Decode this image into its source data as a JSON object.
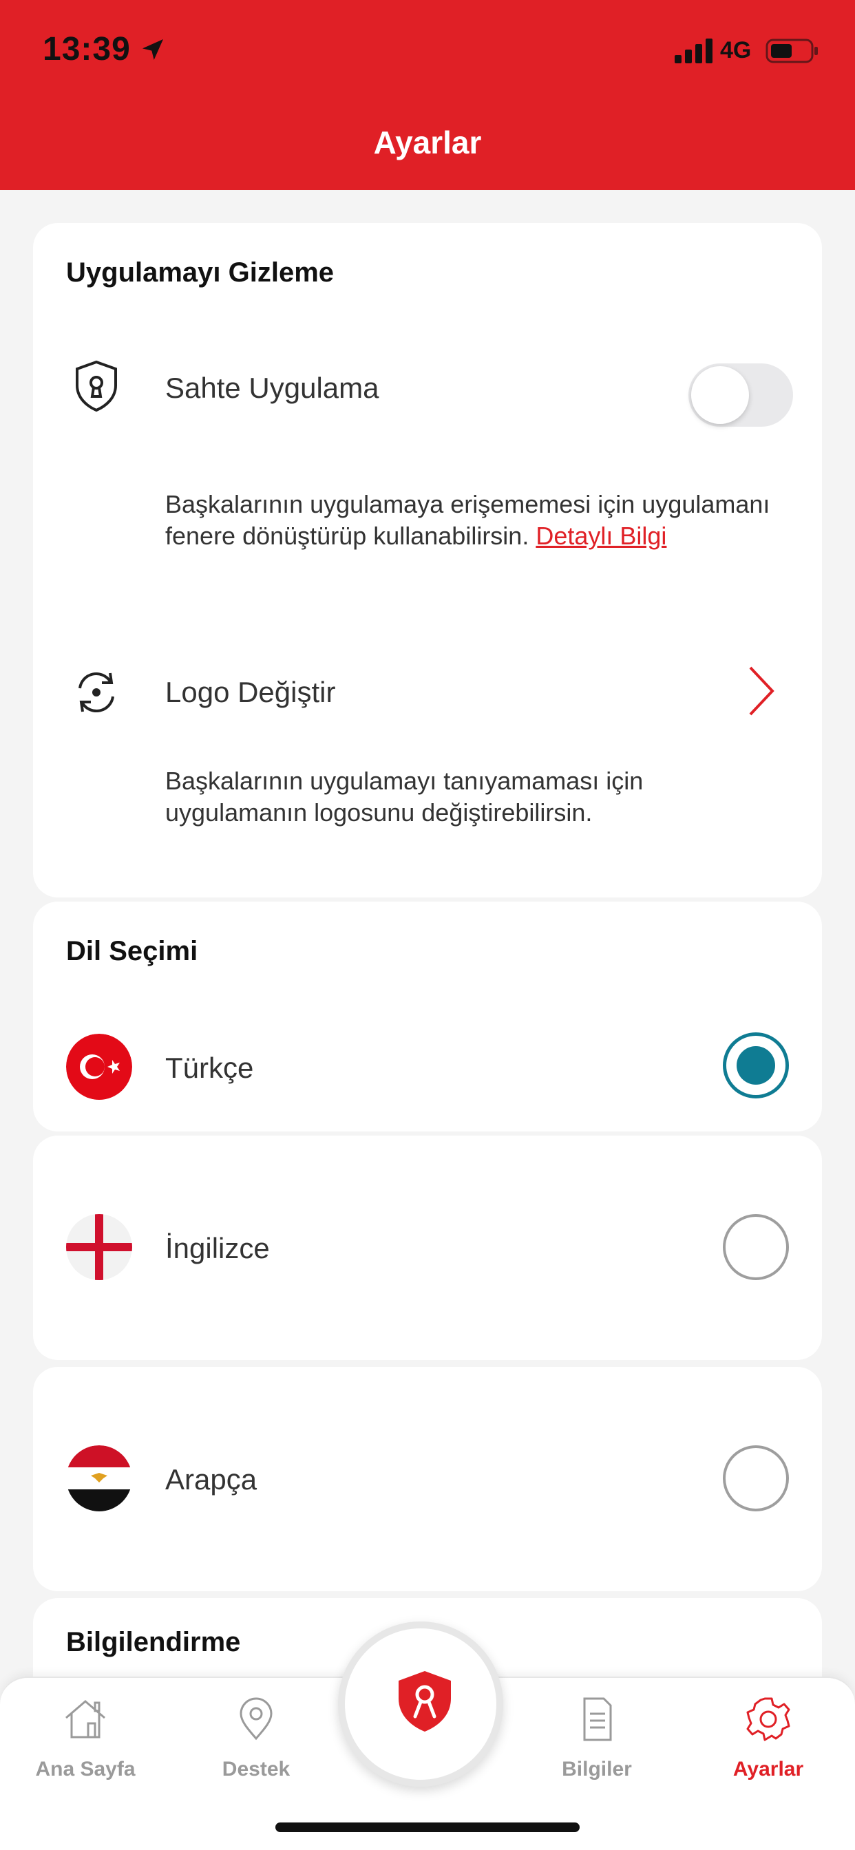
{
  "status_bar": {
    "time": "13:39",
    "network": "4G"
  },
  "header": {
    "title": "Ayarlar"
  },
  "hide_app": {
    "title": "Uygulamayı Gizleme",
    "fake_app_label": "Sahte Uygulama",
    "fake_app_enabled": false,
    "fake_app_desc": "Başkalarının uygulamaya erişememesi için uygulamanı fenere dönüştürüp kullanabilirsin.",
    "fake_app_link": "Detaylı Bilgi",
    "change_logo_label": "Logo Değiştir",
    "change_logo_desc_line1": "Başkalarının uygulamayı tanıyamaması için",
    "change_logo_desc_line2": "uygulamanın logosunu değiştirebilirsin."
  },
  "language": {
    "title": "Dil Seçimi",
    "options": [
      {
        "label": "Türkçe",
        "selected": true
      },
      {
        "label": "İngilizce",
        "selected": false
      },
      {
        "label": "Arapça",
        "selected": false
      }
    ]
  },
  "info_section": {
    "title": "Bilgilendirme"
  },
  "tabbar": {
    "items": [
      {
        "label": "Ana Sayfa",
        "icon": "home-icon"
      },
      {
        "label": "Destek",
        "icon": "location-pin-icon"
      },
      {
        "label": "Bilgiler",
        "icon": "document-icon"
      },
      {
        "label": "Ayarlar",
        "icon": "gear-icon"
      }
    ],
    "active": "Ayarlar"
  },
  "colors": {
    "brand_red": "#e02026",
    "radio_teal": "#0f7c93"
  }
}
